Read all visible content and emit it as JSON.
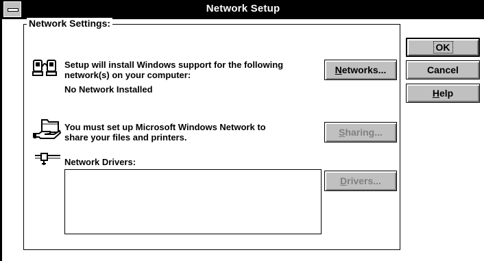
{
  "window": {
    "title": "Network Setup"
  },
  "group": {
    "label": "Network Settings:"
  },
  "networks": {
    "line1": "Setup will install Windows support for the following",
    "line2": "network(s) on your computer:",
    "status": "No Network Installed",
    "button_label": "Networks...",
    "button_mnemonic": "N",
    "button_rest": "etworks..."
  },
  "sharing": {
    "line1": "You must set up Microsoft Windows Network to",
    "line2": "share your files and printers.",
    "button_label": "Sharing...",
    "button_mnemonic": "S",
    "button_rest": "haring..."
  },
  "drivers": {
    "label": "Network Drivers:",
    "items": [],
    "button_label": "Drivers...",
    "button_mnemonic": "D",
    "button_rest": "rivers..."
  },
  "buttons": {
    "ok": "OK",
    "cancel": "Cancel",
    "help_label": "Help",
    "help_mnemonic": "H",
    "help_rest": "elp"
  },
  "icons": {
    "system_menu": "system-menu-icon",
    "networks": "network-computers-icon",
    "sharing": "shared-folder-hand-icon",
    "drivers": "network-cable-icon"
  }
}
